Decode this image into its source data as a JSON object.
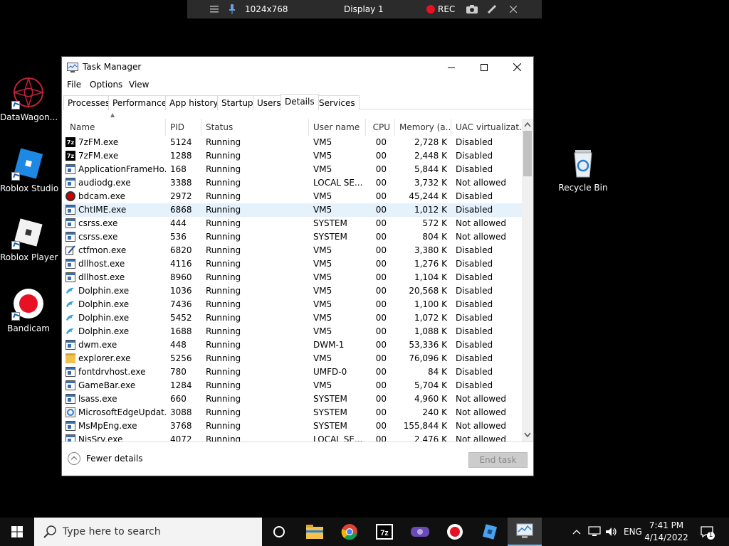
{
  "remote_toolbar": {
    "resolution": "1024x768",
    "display": "Display 1",
    "rec": "REC"
  },
  "desktop_icons": [
    {
      "label": "DataWagon...",
      "icon": "datawagon-icon"
    },
    {
      "label": "Roblox Studio",
      "icon": "roblox-studio-icon"
    },
    {
      "label": "Roblox Player",
      "icon": "roblox-player-icon"
    },
    {
      "label": "Bandicam",
      "icon": "bandicam-icon"
    },
    {
      "label": "Recycle Bin",
      "icon": "recycle-bin-icon"
    }
  ],
  "window": {
    "title": "Task Manager",
    "menu": [
      "File",
      "Options",
      "View"
    ],
    "tabs": [
      "Processes",
      "Performance",
      "App history",
      "Startup",
      "Users",
      "Details",
      "Services"
    ],
    "active_tab": "Details",
    "columns": [
      "Name",
      "PID",
      "Status",
      "User name",
      "CPU",
      "Memory (a...",
      "UAC virtualizat..."
    ],
    "rows": [
      {
        "icon": "7z",
        "name": "7zFM.exe",
        "pid": "5124",
        "status": "Running",
        "user": "VM5",
        "cpu": "00",
        "mem": "2,728 K",
        "uac": "Disabled"
      },
      {
        "icon": "7z",
        "name": "7zFM.exe",
        "pid": "1288",
        "status": "Running",
        "user": "VM5",
        "cpu": "00",
        "mem": "2,448 K",
        "uac": "Disabled"
      },
      {
        "icon": "app",
        "name": "ApplicationFrameHo...",
        "pid": "168",
        "status": "Running",
        "user": "VM5",
        "cpu": "00",
        "mem": "5,844 K",
        "uac": "Disabled"
      },
      {
        "icon": "app",
        "name": "audiodg.exe",
        "pid": "3388",
        "status": "Running",
        "user": "LOCAL SE...",
        "cpu": "00",
        "mem": "3,732 K",
        "uac": "Not allowed"
      },
      {
        "icon": "rec",
        "name": "bdcam.exe",
        "pid": "2972",
        "status": "Running",
        "user": "VM5",
        "cpu": "00",
        "mem": "45,244 K",
        "uac": "Disabled"
      },
      {
        "icon": "app",
        "name": "ChtIME.exe",
        "pid": "6868",
        "status": "Running",
        "user": "VM5",
        "cpu": "00",
        "mem": "1,012 K",
        "uac": "Disabled"
      },
      {
        "icon": "app",
        "name": "csrss.exe",
        "pid": "444",
        "status": "Running",
        "user": "SYSTEM",
        "cpu": "00",
        "mem": "572 K",
        "uac": "Not allowed"
      },
      {
        "icon": "app",
        "name": "csrss.exe",
        "pid": "536",
        "status": "Running",
        "user": "SYSTEM",
        "cpu": "00",
        "mem": "804 K",
        "uac": "Not allowed"
      },
      {
        "icon": "pen",
        "name": "ctfmon.exe",
        "pid": "6820",
        "status": "Running",
        "user": "VM5",
        "cpu": "00",
        "mem": "3,380 K",
        "uac": "Disabled"
      },
      {
        "icon": "app",
        "name": "dllhost.exe",
        "pid": "4116",
        "status": "Running",
        "user": "VM5",
        "cpu": "00",
        "mem": "1,276 K",
        "uac": "Disabled"
      },
      {
        "icon": "app",
        "name": "dllhost.exe",
        "pid": "8960",
        "status": "Running",
        "user": "VM5",
        "cpu": "00",
        "mem": "1,104 K",
        "uac": "Disabled"
      },
      {
        "icon": "dolphin",
        "name": "Dolphin.exe",
        "pid": "1036",
        "status": "Running",
        "user": "VM5",
        "cpu": "00",
        "mem": "20,568 K",
        "uac": "Disabled"
      },
      {
        "icon": "dolphin",
        "name": "Dolphin.exe",
        "pid": "7436",
        "status": "Running",
        "user": "VM5",
        "cpu": "00",
        "mem": "1,100 K",
        "uac": "Disabled"
      },
      {
        "icon": "dolphin",
        "name": "Dolphin.exe",
        "pid": "5452",
        "status": "Running",
        "user": "VM5",
        "cpu": "00",
        "mem": "1,072 K",
        "uac": "Disabled"
      },
      {
        "icon": "dolphin",
        "name": "Dolphin.exe",
        "pid": "1688",
        "status": "Running",
        "user": "VM5",
        "cpu": "00",
        "mem": "1,088 K",
        "uac": "Disabled"
      },
      {
        "icon": "app",
        "name": "dwm.exe",
        "pid": "448",
        "status": "Running",
        "user": "DWM-1",
        "cpu": "00",
        "mem": "53,336 K",
        "uac": "Disabled"
      },
      {
        "icon": "folder",
        "name": "explorer.exe",
        "pid": "5256",
        "status": "Running",
        "user": "VM5",
        "cpu": "00",
        "mem": "76,096 K",
        "uac": "Disabled"
      },
      {
        "icon": "app",
        "name": "fontdrvhost.exe",
        "pid": "780",
        "status": "Running",
        "user": "UMFD-0",
        "cpu": "00",
        "mem": "84 K",
        "uac": "Disabled"
      },
      {
        "icon": "app",
        "name": "GameBar.exe",
        "pid": "1284",
        "status": "Running",
        "user": "VM5",
        "cpu": "00",
        "mem": "5,704 K",
        "uac": "Disabled"
      },
      {
        "icon": "app",
        "name": "lsass.exe",
        "pid": "660",
        "status": "Running",
        "user": "SYSTEM",
        "cpu": "00",
        "mem": "4,960 K",
        "uac": "Not allowed"
      },
      {
        "icon": "edge",
        "name": "MicrosoftEdgeUpdat...",
        "pid": "3088",
        "status": "Running",
        "user": "SYSTEM",
        "cpu": "00",
        "mem": "240 K",
        "uac": "Not allowed"
      },
      {
        "icon": "app",
        "name": "MsMpEng.exe",
        "pid": "3768",
        "status": "Running",
        "user": "SYSTEM",
        "cpu": "00",
        "mem": "155,844 K",
        "uac": "Not allowed"
      },
      {
        "icon": "app",
        "name": "NisSrv.exe",
        "pid": "4072",
        "status": "Running",
        "user": "LOCAL SE...",
        "cpu": "00",
        "mem": "2,476 K",
        "uac": "Not allowed"
      }
    ],
    "selected_row": 5,
    "fewer_details": "Fewer details",
    "end_task": "End task"
  },
  "taskbar": {
    "search_placeholder": "Type here to search",
    "apps": [
      "cortana-icon",
      "file-explorer-icon",
      "chrome-icon",
      "7zip-icon",
      "dolphin-emulator-icon",
      "bandicam-icon",
      "roblox-studio-icon",
      "task-manager-icon"
    ],
    "lang": "ENG",
    "time": "7:41 PM",
    "date": "4/14/2022",
    "notification_count": "1"
  },
  "colors": {
    "accent": "#0078d7",
    "selected_row": "#e5f1fb",
    "taskbar": "#101010",
    "rec_red": "#e81123"
  }
}
